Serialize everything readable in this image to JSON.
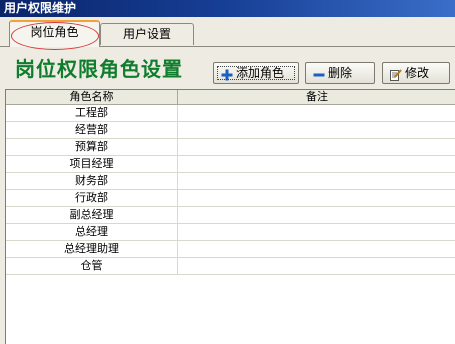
{
  "window": {
    "title": "用户权限维护"
  },
  "tabs": [
    {
      "label": "岗位角色",
      "active": true
    },
    {
      "label": "用户设置",
      "active": false
    }
  ],
  "heading": "岗位权限角色设置",
  "toolbar": {
    "add_label": "添加角色",
    "add_icon": "plus-icon",
    "delete_label": "删除",
    "delete_icon": "minus-icon",
    "edit_label": "修改",
    "edit_icon": "edit-icon"
  },
  "table": {
    "columns": [
      "角色名称",
      "备注"
    ],
    "rows": [
      {
        "name": "工程部",
        "remark": ""
      },
      {
        "name": "经营部",
        "remark": ""
      },
      {
        "name": "预算部",
        "remark": ""
      },
      {
        "name": "项目经理",
        "remark": ""
      },
      {
        "name": "财务部",
        "remark": ""
      },
      {
        "name": "行政部",
        "remark": ""
      },
      {
        "name": "副总经理",
        "remark": ""
      },
      {
        "name": "总经理",
        "remark": ""
      },
      {
        "name": "总经理助理",
        "remark": ""
      },
      {
        "name": "仓管",
        "remark": ""
      }
    ]
  },
  "colors": {
    "title_bar": "#0a246a",
    "heading": "#0f7d2d",
    "annotation_circle": "#d23a3a",
    "plus_icon": "#1c5fc4"
  }
}
